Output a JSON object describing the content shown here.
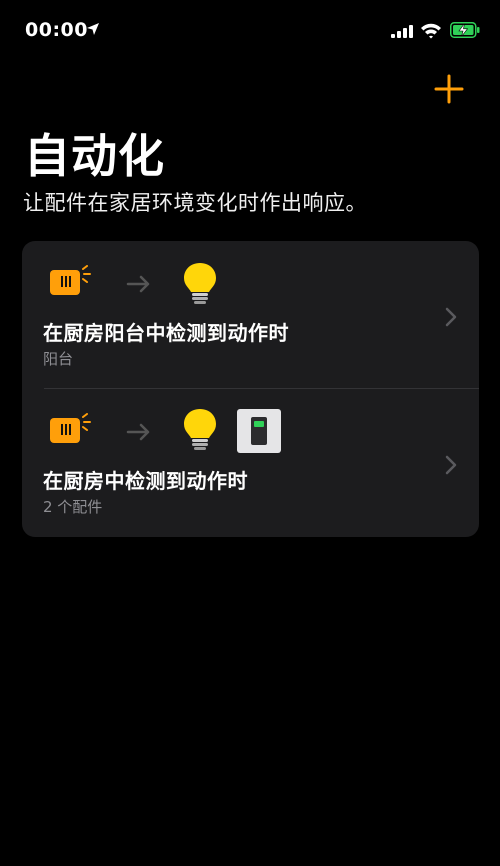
{
  "status_bar": {
    "time": "00:00"
  },
  "header": {
    "title": "自动化",
    "subtitle": "让配件在家居环境变化时作出响应。"
  },
  "automations": [
    {
      "title": "在厨房阳台中检测到动作时",
      "subtitle": "阳台",
      "icons": [
        "motion-sensor-icon",
        "arrow-icon",
        "lightbulb-icon"
      ]
    },
    {
      "title": "在厨房中检测到动作时",
      "subtitle": "2 个配件",
      "icons": [
        "motion-sensor-icon",
        "arrow-icon",
        "lightbulb-icon",
        "switch-icon"
      ]
    }
  ],
  "colors": {
    "accent": "#ff9f0a",
    "bulb": "#ffd60a",
    "card": "#1c1c1e",
    "battery": "#30d158"
  }
}
